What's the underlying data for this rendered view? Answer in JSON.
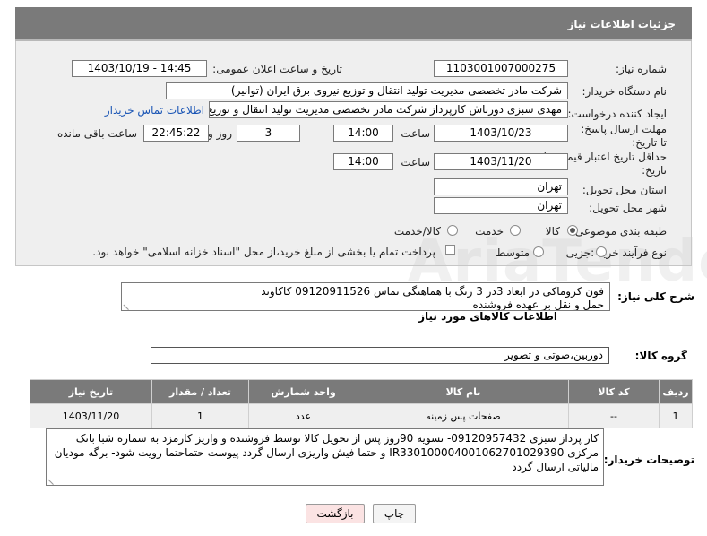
{
  "header": {
    "title": "جزئیات اطلاعات نیاز"
  },
  "fields": {
    "need_number_label": "شماره نیاز:",
    "need_number": "1103001007000275",
    "announce_label": "تاریخ و ساعت اعلان عمومی:",
    "announce_value": "1403/10/19 - 14:45",
    "buyer_org_label": "نام دستگاه خریدار:",
    "buyer_org": "شرکت مادر تخصصی مدیریت تولید  انتقال و توزیع نیروی برق ایران (توانیر)",
    "creator_label": "ایجاد کننده درخواست:",
    "creator": "مهدی سبزی دورباش کارپرداز شرکت مادر تخصصی مدیریت تولید  انتقال و توزیع ن",
    "contact_link": "اطلاعات تماس خریدار",
    "deadline_label": "مهلت ارسال پاسخ: تا تاریخ:",
    "deadline_date": "1403/10/23",
    "time_label": "ساعت",
    "deadline_time": "14:00",
    "days_value": "3",
    "days_label": "روز و",
    "remaining_time": "22:45:22",
    "remaining_label": "ساعت باقی مانده",
    "validity_label": "حداقل تاریخ اعتبار قیمت: تا تاریخ:",
    "validity_date": "1403/11/20",
    "validity_time": "14:00",
    "province_label": "استان محل تحویل:",
    "province": "تهران",
    "city_label": "شهر محل تحویل:",
    "city": "تهران",
    "category_label": "طبقه بندی موضوعی:",
    "category_options": [
      "کالا",
      "خدمت",
      "کالا/خدمت"
    ],
    "category_selected": "کالا",
    "purchase_label": "نوع فرآیند خرید :",
    "purchase_options": [
      "جزیی",
      "متوسط"
    ],
    "payment_note": "پرداخت تمام یا بخشی از مبلغ خرید،از محل \"اسناد خزانه اسلامی\" خواهد بود."
  },
  "description": {
    "label": "شرح کلی نیاز:",
    "text_line1": "فون کروماکی در ابعاد 3در 3 رنگ با هماهنگی تماس 09120911526 کاکاوند",
    "text_line2": "حمل و نقل بر عهده فروشنده"
  },
  "items_section": {
    "title": "اطلاعات کالاهای مورد نیاز",
    "group_label": "گروه کالا:",
    "group_value": "دوربین،صوتی و تصویر",
    "columns": [
      "ردیف",
      "کد کالا",
      "نام کالا",
      "واحد شمارش",
      "تعداد / مقدار",
      "تاریخ نیاز"
    ],
    "rows": [
      [
        "1",
        "--",
        "صفحات پس زمینه",
        "عدد",
        "1",
        "1403/11/20"
      ]
    ]
  },
  "buyer_notes": {
    "label": "توضیحات خریدار:",
    "text": "کار پرداز سبزی 09120957432- تسویه 90روز پس از تحویل کالا توسط فروشنده و واریز کارمزد به شماره شبا بانک مرکزی IR330100004001062701029390 و حتما فیش واریزی ارسال گردد پیوست حتماحتما رویت شود- برگه مودیان مالیاتی ارسال گردد"
  },
  "buttons": {
    "print": "چاپ",
    "back": "بازگشت"
  },
  "colors": {
    "header_bg": "#7a7a7a",
    "panel_bg": "#efefef",
    "link": "#1a55b5",
    "back_button_bg": "#fbe3e3"
  }
}
